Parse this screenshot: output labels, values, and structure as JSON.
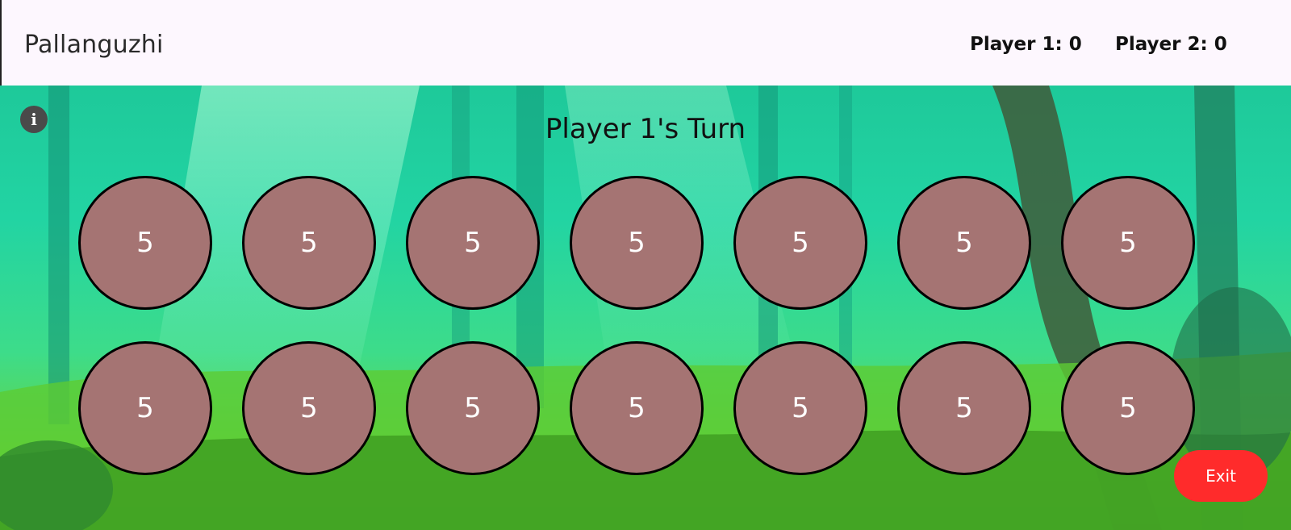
{
  "app_bar": {
    "title": "Pallanguzhi",
    "player1_score_label": "Player 1: 0",
    "player2_score_label": "Player 2: 0"
  },
  "game": {
    "turn_label": "Player 1's Turn",
    "info_icon": "info-icon",
    "info_glyph": "i",
    "top_row": [
      "5",
      "5",
      "5",
      "5",
      "5",
      "5",
      "5"
    ],
    "bottom_row": [
      "5",
      "5",
      "5",
      "5",
      "5",
      "5",
      "5"
    ],
    "exit_label": "Exit"
  },
  "colors": {
    "app_bar_bg": "#fdf7fe",
    "pit_fill": "#a57473",
    "pit_border": "#000000",
    "exit_button": "#ff2b2b",
    "info_button": "#4a4a4a"
  }
}
